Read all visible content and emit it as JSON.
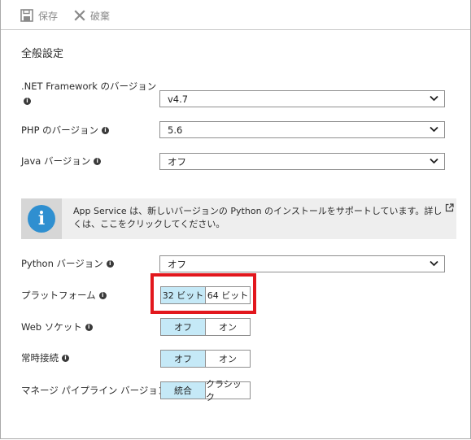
{
  "toolbar": {
    "save_label": "保存",
    "discard_label": "破棄"
  },
  "section": {
    "title": "全般設定"
  },
  "net_framework": {
    "label": ".NET Framework のバージョン",
    "value": "v4.7"
  },
  "php": {
    "label": "PHP のバージョン",
    "value": "5.6"
  },
  "java": {
    "label": "Java バージョン",
    "value": "オフ"
  },
  "notice": {
    "text": "App Service は、新しいバージョンの Python のインストールをサポートしています。詳しくは、ここをクリックしてください。"
  },
  "python": {
    "label": "Python バージョン",
    "value": "オフ"
  },
  "platform": {
    "label": "プラットフォーム",
    "options": [
      "32 ビット",
      "64 ビット"
    ],
    "selected": "32 ビット"
  },
  "websocket": {
    "label": "Web ソケット",
    "options": [
      "オフ",
      "オン"
    ],
    "selected": "オフ"
  },
  "always_on": {
    "label": "常時接続",
    "options": [
      "オフ",
      "オン"
    ],
    "selected": "オフ"
  },
  "pipeline": {
    "label": "マネージ パイプライン バージョン",
    "options": [
      "統合",
      "クラシック"
    ],
    "selected": "統合"
  },
  "colors": {
    "accent_selected": "#c5e9f7",
    "info_blue": "#2f8fd0",
    "highlight_red": "#e2171d"
  },
  "icons": {
    "save": "save-icon",
    "discard": "close-icon",
    "info": "info-icon",
    "notice": "info-circle-icon",
    "external": "external-link-icon",
    "dropdown": "chevron-down-icon"
  }
}
